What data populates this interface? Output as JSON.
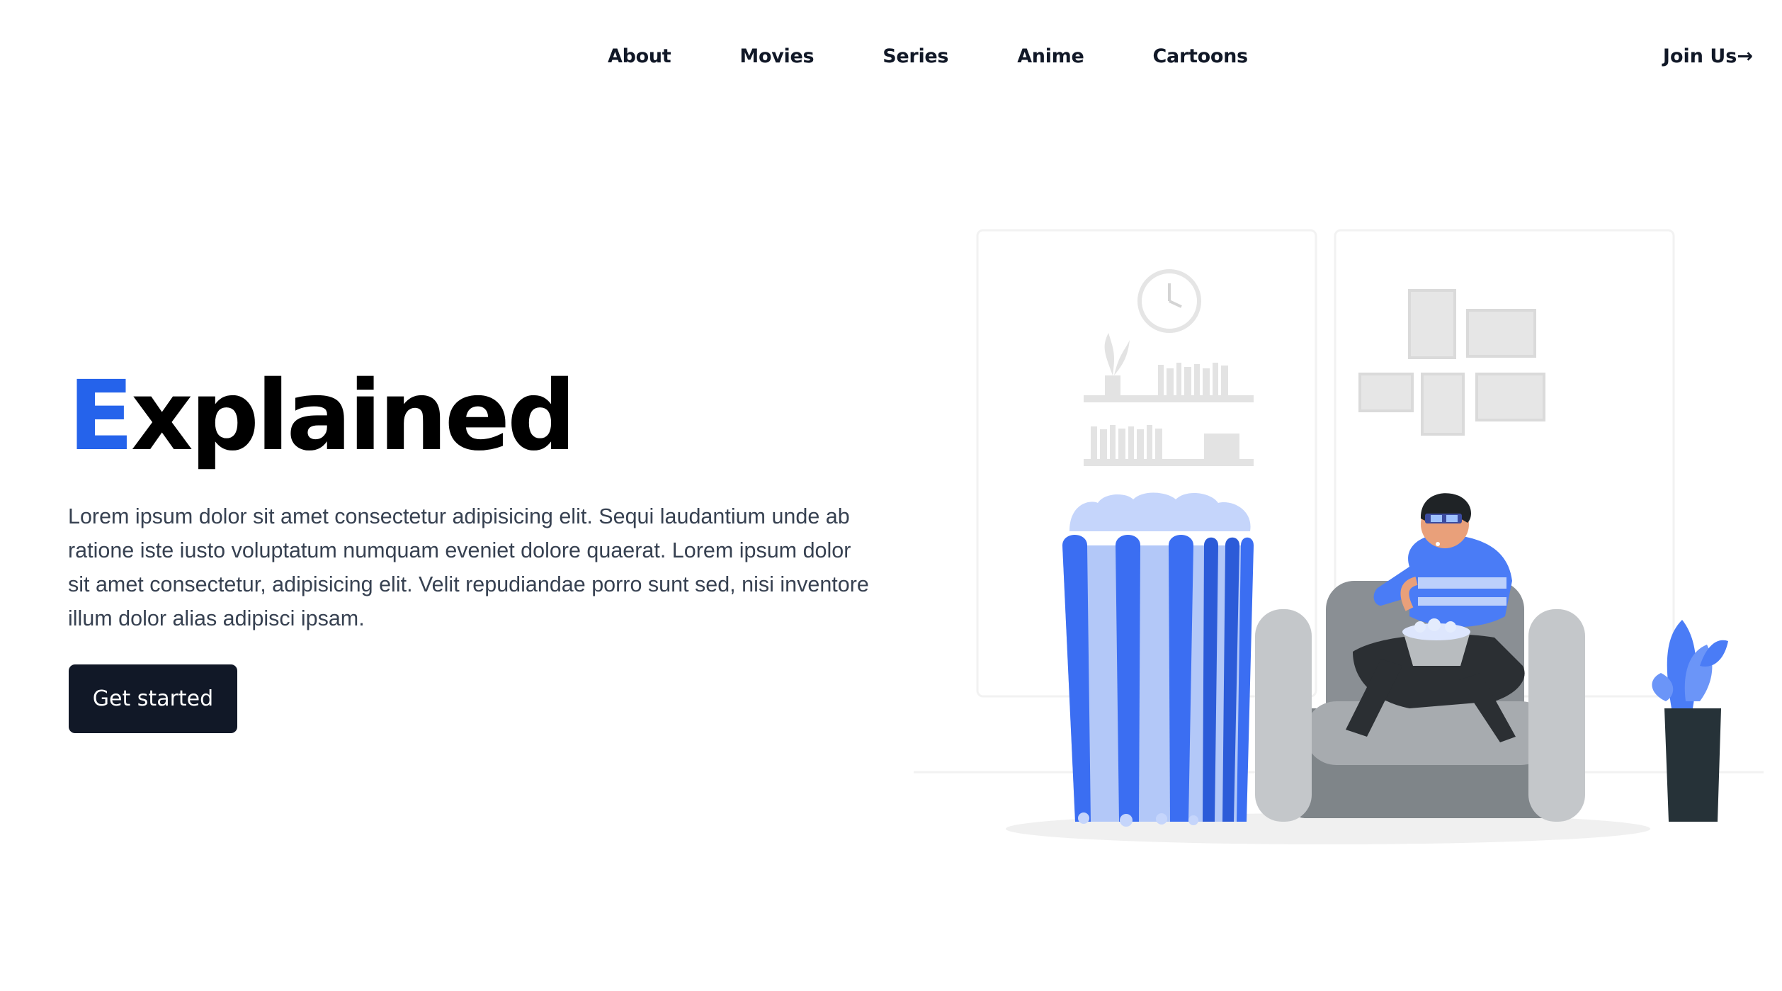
{
  "nav": {
    "links": [
      "About",
      "Movies",
      "Series",
      "Anime",
      "Cartoons"
    ],
    "join_label": "Join Us→"
  },
  "hero": {
    "title_accent": "E",
    "title_rest": "xplained",
    "description": "Lorem ipsum dolor sit amet consectetur adipisicing elit. Sequi laudantium unde ab ratione iste iusto voluptatum numquam eveniet dolore quaerat. Lorem ipsum dolor sit amet consectetur, adipisicing elit. Velit repudiandae porro sunt sed, nisi inventore illum dolor alias adipisci ipsam.",
    "cta_label": "Get started"
  },
  "colors": {
    "accent": "#2563eb",
    "button_bg": "#111827",
    "illustration_blue": "#4a7cf6"
  },
  "illustration": {
    "icon": "person-watching-movie-with-popcorn-illustration"
  }
}
